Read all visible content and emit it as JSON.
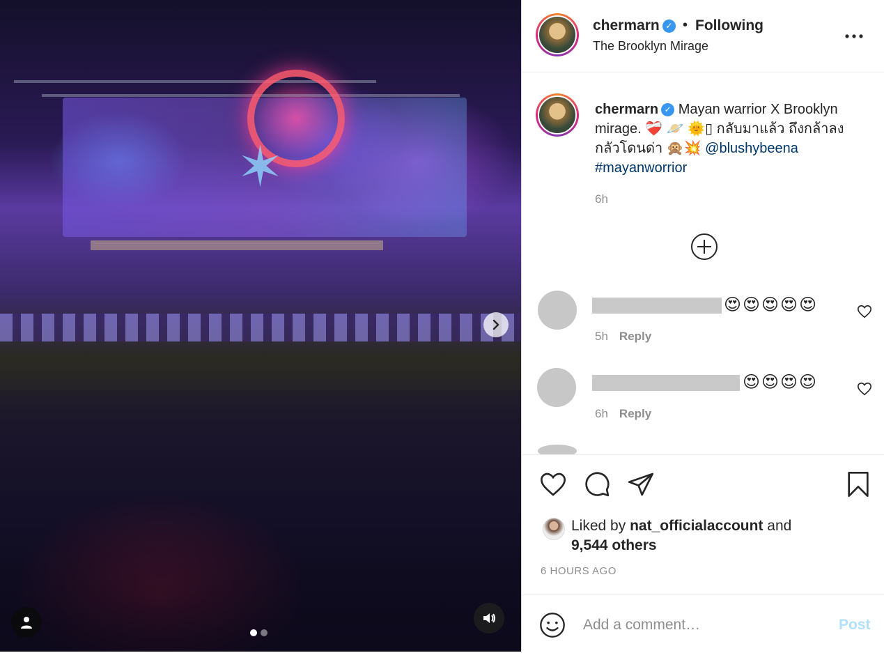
{
  "media": {
    "slide_count": 2,
    "active_slide": 1
  },
  "header": {
    "username": "chermarn",
    "separator": "•",
    "follow_status": "Following",
    "location": "The Brooklyn Mirage"
  },
  "caption": {
    "username": "chermarn",
    "text_line1": "Mayan warrior X Brooklyn mirage. ❤️‍🩹 🪐 🌞▯ กลับมาแล้ว ถึงกล้าลง กลัวโดนด่า 🙊💥",
    "mention": "@blushybeena",
    "hashtag": "#mayanworrior",
    "time": "6h"
  },
  "comments": [
    {
      "emojis": "😍😍😍😍😍",
      "time": "5h",
      "reply_label": "Reply"
    },
    {
      "emojis": "😍😍😍😍",
      "time": "6h",
      "reply_label": "Reply"
    }
  ],
  "likes": {
    "prefix": "Liked by ",
    "user": "nat_officialaccount",
    "middle": " and",
    "others": "9,544 others"
  },
  "timestamp": "6 HOURS AGO",
  "add_comment": {
    "placeholder": "Add a comment…",
    "post_label": "Post"
  },
  "colors": {
    "verified": "#3897f0",
    "link": "#00376b",
    "post_disabled": "#b2dffc",
    "muted": "#8e8e8e"
  }
}
